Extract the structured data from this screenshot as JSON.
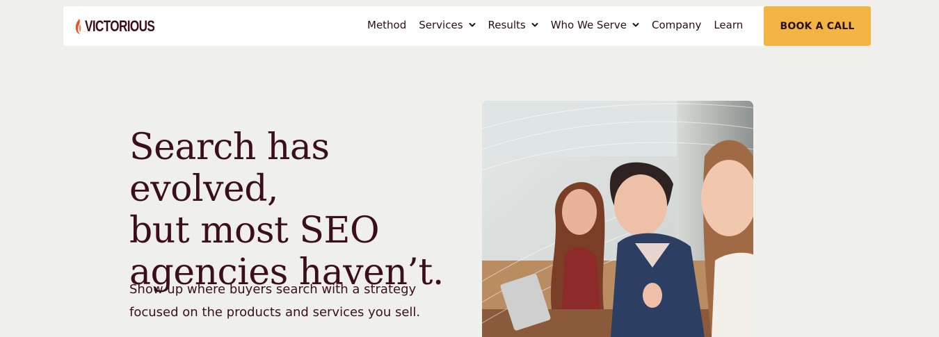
{
  "nav": {
    "logo_text": "VICTORIOUS",
    "items": [
      {
        "label": "Method",
        "has_dropdown": false
      },
      {
        "label": "Services",
        "has_dropdown": true
      },
      {
        "label": "Results",
        "has_dropdown": true
      },
      {
        "label": "Who We Serve",
        "has_dropdown": true
      },
      {
        "label": "Company",
        "has_dropdown": false
      },
      {
        "label": "Learn",
        "has_dropdown": false
      }
    ],
    "cta_label": "BOOK A CALL"
  },
  "hero": {
    "headline_lines": [
      "Search has evolved,",
      "but most SEO",
      "agencies haven’t."
    ],
    "subtext_lines": [
      "Show up where buyers search with a strategy",
      "focused on the products and services you sell."
    ],
    "image_alt": "Three women laughing at a meeting table"
  },
  "colors": {
    "background": "#efefeb",
    "brand": "#3a0f1a",
    "accent": "#f2b544",
    "logo_flame": "#e4572e"
  },
  "icons": {
    "dropdown": "chevron-down-icon",
    "logo": "flame-icon"
  }
}
